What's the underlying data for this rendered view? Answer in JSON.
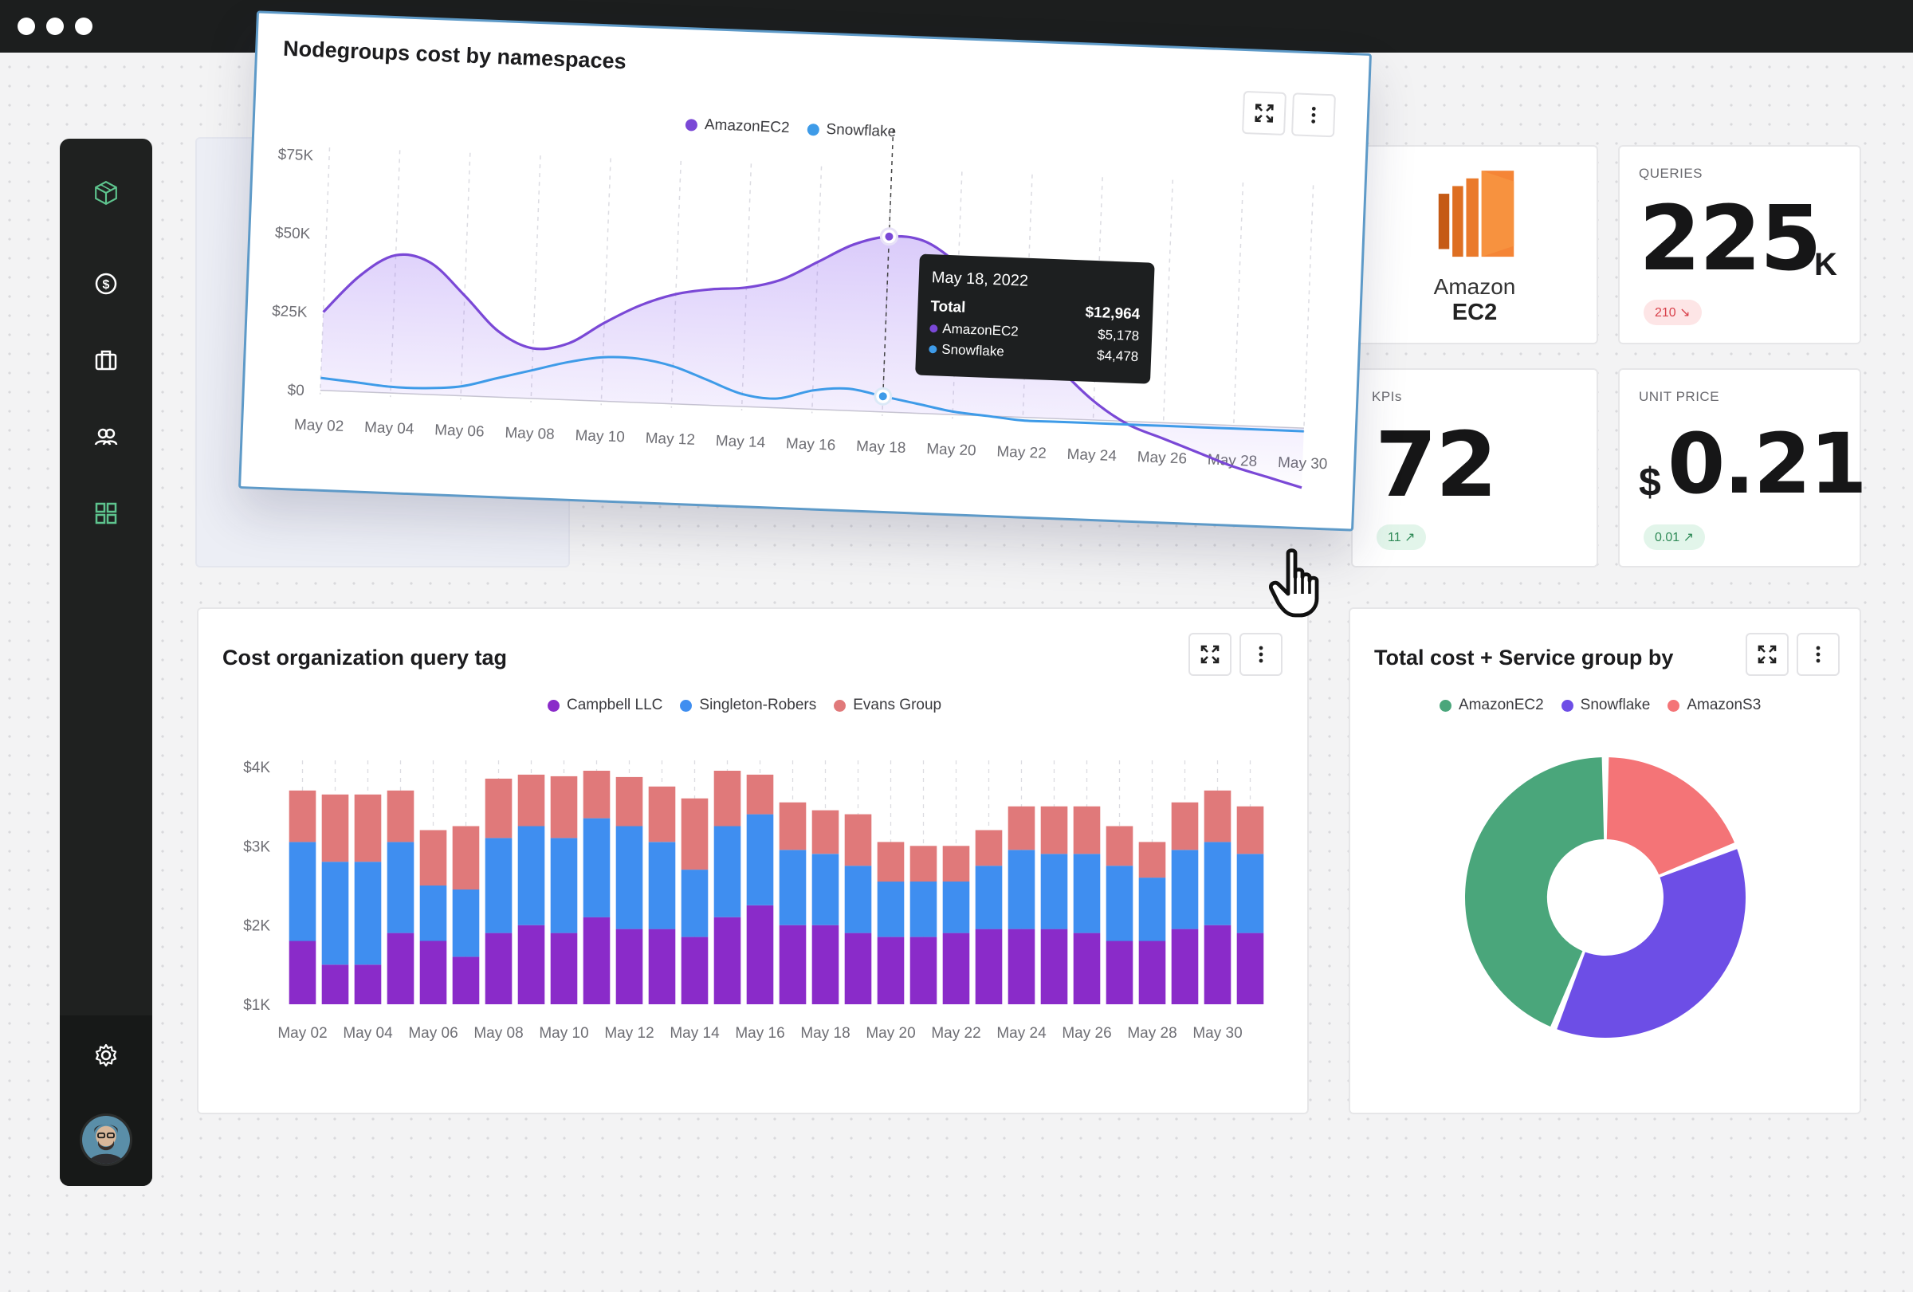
{
  "window": {
    "traffic_lights": [
      "close",
      "minimize",
      "zoom"
    ]
  },
  "sidebar": {
    "logo_icon": "cube-logo-icon",
    "items": [
      {
        "icon": "dollar-icon",
        "active": false
      },
      {
        "icon": "briefcase-icon",
        "active": false
      },
      {
        "icon": "users-icon",
        "active": false
      },
      {
        "icon": "grid-icon",
        "active": true
      }
    ],
    "settings_icon": "gear-icon",
    "avatar": "user-avatar"
  },
  "nodegroups_card": {
    "title": "Nodegroups cost by namespaces",
    "tooltip": {
      "date": "May 18, 2022",
      "total_label": "Total",
      "total_value": "$12,964",
      "rows": [
        {
          "label": "AmazonEC2",
          "value": "$5,178",
          "color": "#7a48d6"
        },
        {
          "label": "Snowflake",
          "value": "$4,478",
          "color": "#3e9be8"
        }
      ]
    }
  },
  "kpi": {
    "queries": {
      "label": "QUERIES",
      "value": "225",
      "suffix": "K",
      "change": "210 ↘",
      "trend": "down"
    },
    "kpis": {
      "label": "KPIs",
      "value": "72",
      "change": "11 ↗",
      "trend": "up"
    },
    "unit_price": {
      "label": "UNIT PRICE",
      "currency": "$",
      "value": "0.21",
      "change": "0.01 ↗",
      "trend": "up"
    },
    "amazon": {
      "line1": "Amazon",
      "line2": "EC2",
      "color": "#f58536"
    }
  },
  "cost_card": {
    "title": "Cost organization query tag"
  },
  "total_card": {
    "title": "Total cost + Service group by"
  },
  "chart_data": [
    {
      "type": "area",
      "title": "Nodegroups cost by namespaces",
      "x": [
        "May 02",
        "May 03",
        "May 04",
        "May 05",
        "May 06",
        "May 07",
        "May 08",
        "May 09",
        "May 10",
        "May 11",
        "May 12",
        "May 13",
        "May 14",
        "May 15",
        "May 16",
        "May 17",
        "May 18",
        "May 19",
        "May 20",
        "May 21",
        "May 22",
        "May 23",
        "May 24",
        "May 25",
        "May 26",
        "May 27",
        "May 28",
        "May 29",
        "May 30"
      ],
      "x_tick_labels": [
        "May 02",
        "May 04",
        "May 06",
        "May 08",
        "May 10",
        "May 12",
        "May 14",
        "May 16",
        "May 18",
        "May 20",
        "May 22",
        "May 24",
        "May 26",
        "May 28",
        "May 30"
      ],
      "y_tick_labels": [
        "$0",
        "$25K",
        "$50K",
        "$75K"
      ],
      "ylim": [
        0,
        75000
      ],
      "series": [
        {
          "name": "AmazonEC2",
          "color": "#7a48d6",
          "values": [
            25000,
            37000,
            44000,
            42000,
            32000,
            21000,
            16000,
            18000,
            25000,
            31000,
            35000,
            37000,
            38000,
            41000,
            47000,
            53000,
            56000,
            55000,
            48000,
            38000,
            28000,
            16000,
            6000,
            -1000,
            -5000,
            -9000,
            -13000,
            -16000,
            -19000
          ]
        },
        {
          "name": "Snowflake",
          "color": "#3e9be8",
          "values": [
            4000,
            3000,
            2000,
            2000,
            3000,
            6000,
            9000,
            12000,
            14000,
            14000,
            12000,
            8000,
            4000,
            3000,
            6000,
            7000,
            5000,
            3000,
            1000,
            0,
            -1000,
            -1000,
            -1000,
            -1000,
            -1000,
            -1000,
            -1000,
            -1000,
            -1000
          ]
        }
      ]
    },
    {
      "type": "bar",
      "stacked": true,
      "title": "Cost organization query tag",
      "x_tick_labels": [
        "May 02",
        "May 04",
        "May 06",
        "May 08",
        "May 10",
        "May 12",
        "May 14",
        "May 16",
        "May 18",
        "May 20",
        "May 22",
        "May 24",
        "May 26",
        "May 28",
        "May 30"
      ],
      "y_tick_labels": [
        "$1K",
        "$2K",
        "$3K",
        "$4K"
      ],
      "ylim": [
        1000,
        4000
      ],
      "series": [
        {
          "name": "Campbell LLC",
          "color": "#8a2bc9",
          "values": [
            1800,
            1500,
            1500,
            1900,
            1800,
            1600,
            1900,
            2000,
            1900,
            2100,
            1950,
            1950,
            1850,
            2100,
            2250,
            2000,
            2000,
            1900,
            1850,
            1850,
            1900,
            1950,
            1950,
            1950,
            1900,
            1800,
            1800,
            1950,
            2000,
            1900
          ]
        },
        {
          "name": "Singleton-Robers",
          "color": "#3f8ef0",
          "values": [
            3050,
            2800,
            2800,
            3050,
            2500,
            2450,
            3100,
            3250,
            3100,
            3350,
            3250,
            3050,
            2700,
            3250,
            3400,
            2950,
            2900,
            2750,
            2550,
            2550,
            2550,
            2750,
            2950,
            2900,
            2900,
            2750,
            2600,
            2950,
            3050,
            2900
          ]
        },
        {
          "name": "Evans Group",
          "color": "#e0797a",
          "values": [
            3700,
            3650,
            3650,
            3700,
            3200,
            3250,
            3850,
            3900,
            3880,
            3950,
            3870,
            3750,
            3600,
            3950,
            3900,
            3550,
            3450,
            3400,
            3050,
            3000,
            3000,
            3200,
            3500,
            3500,
            3500,
            3250,
            3050,
            3550,
            3700,
            3500
          ]
        }
      ]
    },
    {
      "type": "pie",
      "donut": true,
      "title": "Total cost + Service group by",
      "series": [
        {
          "name": "AmazonEC2",
          "color": "#4aa67b",
          "value": 44
        },
        {
          "name": "Snowflake",
          "color": "#6d4ee6",
          "value": 37
        },
        {
          "name": "AmazonS3",
          "color": "#f47477",
          "value": 19
        }
      ]
    }
  ]
}
